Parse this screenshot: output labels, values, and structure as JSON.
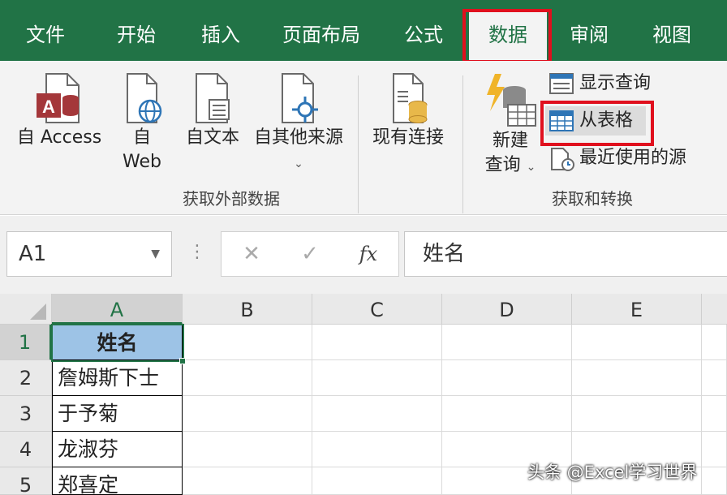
{
  "tabs": [
    {
      "label": "文件"
    },
    {
      "label": "开始"
    },
    {
      "label": "插入"
    },
    {
      "label": "页面布局"
    },
    {
      "label": "公式"
    },
    {
      "label": "数据",
      "active": true
    },
    {
      "label": "审阅"
    },
    {
      "label": "视图"
    }
  ],
  "ribbon": {
    "get_external": {
      "group_label": "获取外部数据",
      "from_access": {
        "line1": "自 Access"
      },
      "from_web": {
        "line1": "自",
        "line2": "Web"
      },
      "from_text": {
        "line1": "自文本"
      },
      "from_other": {
        "line1": "自其他来源",
        "caret": "⌄"
      }
    },
    "existing_connections": {
      "line1": "现有连接"
    },
    "get_transform": {
      "group_label": "获取和转换",
      "new_query": {
        "line1": "新建",
        "line2": "查询",
        "caret": "⌄"
      },
      "show_queries": "显示查询",
      "from_table": "从表格",
      "recent_sources": "最近使用的源"
    }
  },
  "formula_bar": {
    "name_box": "A1",
    "cancel": "✕",
    "enter": "✓",
    "fx": "fx",
    "value": "姓名"
  },
  "grid": {
    "columns": [
      "A",
      "B",
      "C",
      "D",
      "E"
    ],
    "rows": [
      "1",
      "2",
      "3",
      "4",
      "5"
    ],
    "column_a_values": [
      "姓名",
      "詹姆斯下士",
      "于予菊",
      "龙淑芬",
      "郑喜定"
    ]
  },
  "watermark": "头条 @Excel学习世界",
  "colors": {
    "excel_green": "#217346",
    "highlight_red": "#e0101e",
    "header_fill": "#9dc3e6"
  }
}
